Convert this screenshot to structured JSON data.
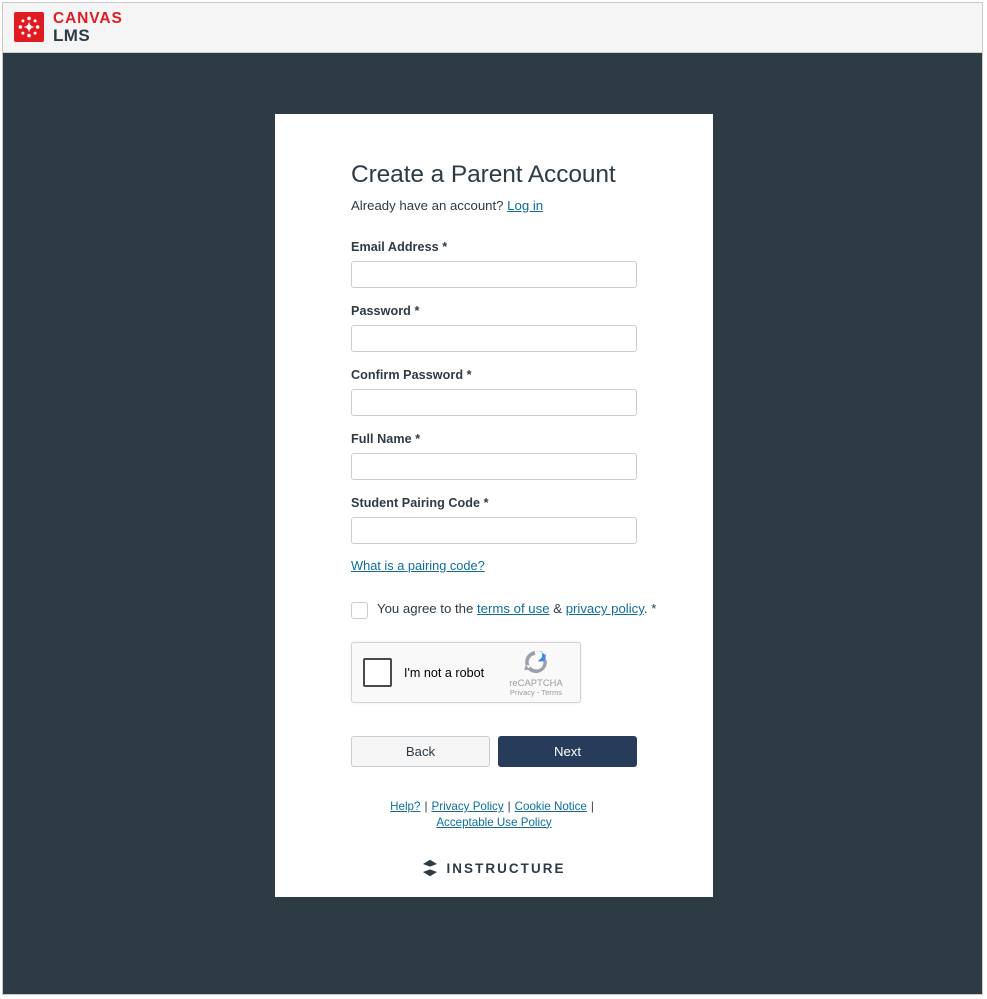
{
  "header": {
    "logo_icon": "canvas-logo-icon",
    "brand_top": "CANVAS",
    "brand_bottom": "LMS"
  },
  "card": {
    "title": "Create a Parent Account",
    "already_prefix": "Already have an account?",
    "login_link": "Log in",
    "fields": [
      {
        "label": "Email Address",
        "required": "*",
        "value": "",
        "placeholder": "",
        "name": "email"
      },
      {
        "label": "Password",
        "required": "*",
        "value": "",
        "placeholder": "",
        "name": "password"
      },
      {
        "label": "Confirm Password",
        "required": "*",
        "value": "",
        "placeholder": "",
        "name": "confirm-password"
      },
      {
        "label": "Full Name",
        "required": "*",
        "value": "",
        "placeholder": "",
        "name": "full-name"
      },
      {
        "label": "Student Pairing Code",
        "required": "*",
        "value": "",
        "placeholder": "",
        "name": "student-pairing-code"
      }
    ],
    "pairing_help_link": "What is a pairing code?",
    "terms": {
      "checked": false,
      "prefix": "You agree to the",
      "terms_link": "terms of use",
      "amp": "&",
      "privacy_link": "privacy policy",
      "period": ".",
      "required": "*"
    },
    "recaptcha": {
      "label": "I'm not a robot",
      "brand": "reCAPTCHA",
      "legal": "Privacy - Terms",
      "icon": "recaptcha-icon",
      "checked": false
    },
    "buttons": {
      "back": "Back",
      "next": "Next"
    },
    "footer": {
      "links": [
        "Help?",
        "Privacy Policy",
        "Cookie Notice",
        "Acceptable Use Policy"
      ],
      "separator": "|",
      "instructure_word": "INSTRUCTURE",
      "instructure_icon": "instructure-logo-icon"
    }
  },
  "colors": {
    "background": "#2d3b45",
    "card": "#ffffff",
    "brand_red": "#e11b22",
    "link": "#0f6d9c",
    "primary_button": "#273c5a",
    "header_bar": "#f5f5f5"
  }
}
